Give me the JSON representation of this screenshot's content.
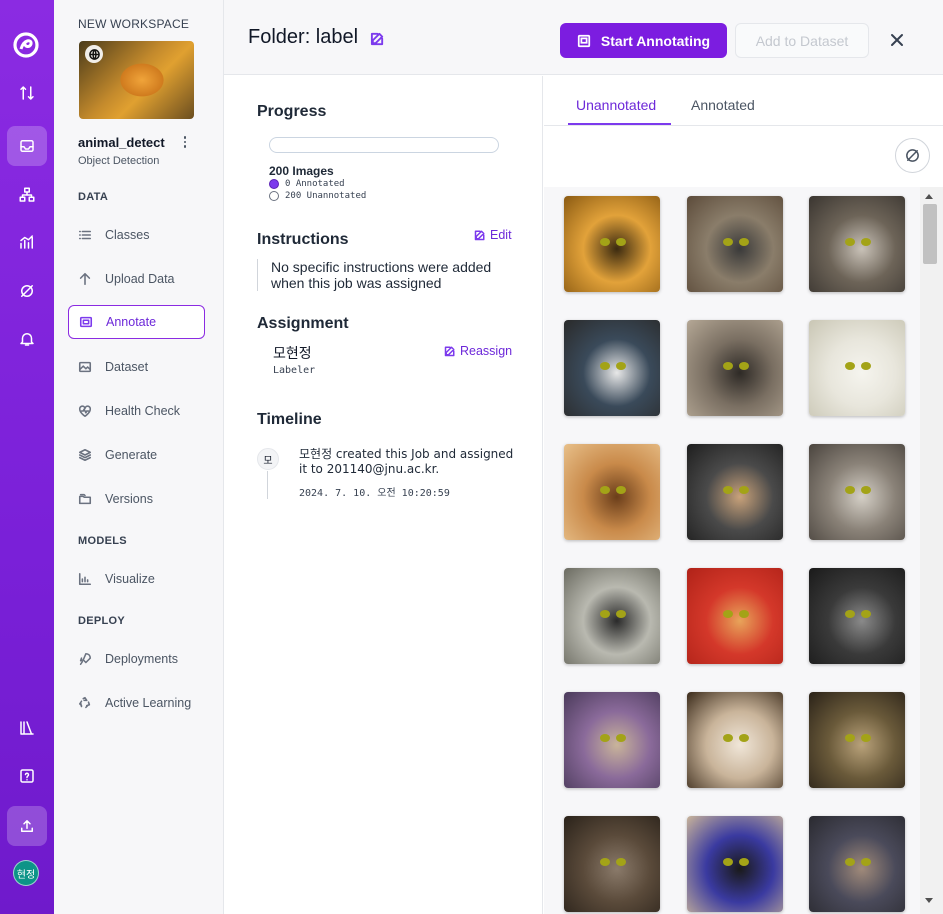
{
  "rail": {
    "items": [
      {
        "name": "upload-download-icon"
      },
      {
        "name": "inbox-icon"
      },
      {
        "name": "hierarchy-icon"
      },
      {
        "name": "analytics-icon"
      },
      {
        "name": "deploy-icon"
      },
      {
        "name": "bell-icon"
      },
      {
        "name": "library-icon"
      },
      {
        "name": "help-icon"
      },
      {
        "name": "upload-icon"
      }
    ],
    "avatar_text": "현정"
  },
  "sidebar": {
    "workspace_label": "NEW WORKSPACE",
    "project_name": "animal_detect",
    "project_type": "Object Detection",
    "sections": {
      "data": "DATA",
      "models": "MODELS",
      "deploy": "DEPLOY"
    },
    "items": {
      "classes": "Classes",
      "upload": "Upload Data",
      "annotate": "Annotate",
      "dataset": "Dataset",
      "health": "Health Check",
      "generate": "Generate",
      "versions": "Versions",
      "visualize": "Visualize",
      "deployments": "Deployments",
      "active_learning": "Active Learning"
    }
  },
  "header": {
    "title": "Folder: label",
    "start_label": "Start Annotating",
    "add_label": "Add to Dataset"
  },
  "info": {
    "progress_title": "Progress",
    "progress_fraction": 0,
    "image_count": "200 Images",
    "annotated": "0 Annotated",
    "unannotated": "200 Unannotated",
    "instructions_title": "Instructions",
    "edit_label": "Edit",
    "instructions_text": "No specific instructions were added when this job was assigned",
    "assignment_title": "Assignment",
    "reassign_label": "Reassign",
    "assignee": "모현정",
    "assignee_role": "Labeler",
    "timeline_title": "Timeline",
    "timeline_avatar": "모",
    "timeline_text": "모현정 created this Job and assigned it to 201140@jnu.ac.kr.",
    "timeline_date": "2024. 7. 10. 오전 10:20:59"
  },
  "tabs": {
    "unannotated": "Unannotated",
    "annotated": "Annotated"
  },
  "gallery": {
    "thumbs": [
      {
        "c1": "#e2a23a",
        "c2": "#3b2a10",
        "c3": "#8a5a12"
      },
      {
        "c1": "#8a7d6a",
        "c2": "#3a3a3a",
        "c3": "#5c4b3a"
      },
      {
        "c1": "#6d6458",
        "c2": "#c9c2b8",
        "c3": "#3a3530"
      },
      {
        "c1": "#3a4a5a",
        "c2": "#e8e8e8",
        "c3": "#2a2a2a"
      },
      {
        "c1": "#7a6f62",
        "c2": "#2e2a26",
        "c3": "#b5a896"
      },
      {
        "c1": "#e8e6dc",
        "c2": "#f5f4ee",
        "c3": "#c9c6b4"
      },
      {
        "c1": "#c98a4a",
        "c2": "#6b3e1a",
        "c3": "#e8c08a"
      },
      {
        "c1": "#4a4a4a",
        "c2": "#c9a27a",
        "c3": "#1e1e1e"
      },
      {
        "c1": "#8a8278",
        "c2": "#d4cfc6",
        "c3": "#4a443e"
      },
      {
        "c1": "#b9b9b0",
        "c2": "#2a2a2a",
        "c3": "#6a6a60"
      },
      {
        "c1": "#d4382a",
        "c2": "#e8a45a",
        "c3": "#b02218"
      },
      {
        "c1": "#3a3a3a",
        "c2": "#8a8a8a",
        "c3": "#1a1a1a"
      },
      {
        "c1": "#8a6a9a",
        "c2": "#c9b49a",
        "c3": "#4a3a5a"
      },
      {
        "c1": "#c9b49a",
        "c2": "#f0e6d8",
        "c3": "#3a2a1a"
      },
      {
        "c1": "#6a5a3a",
        "c2": "#b9a27a",
        "c3": "#2a2218"
      },
      {
        "c1": "#5a4a3a",
        "c2": "#8a7a6a",
        "c3": "#2a221a"
      },
      {
        "c1": "#3a3aa0",
        "c2": "#1a1a1a",
        "c3": "#c9b49a"
      },
      {
        "c1": "#4a4a5a",
        "c2": "#a08a7a",
        "c3": "#2a2a30"
      }
    ]
  }
}
